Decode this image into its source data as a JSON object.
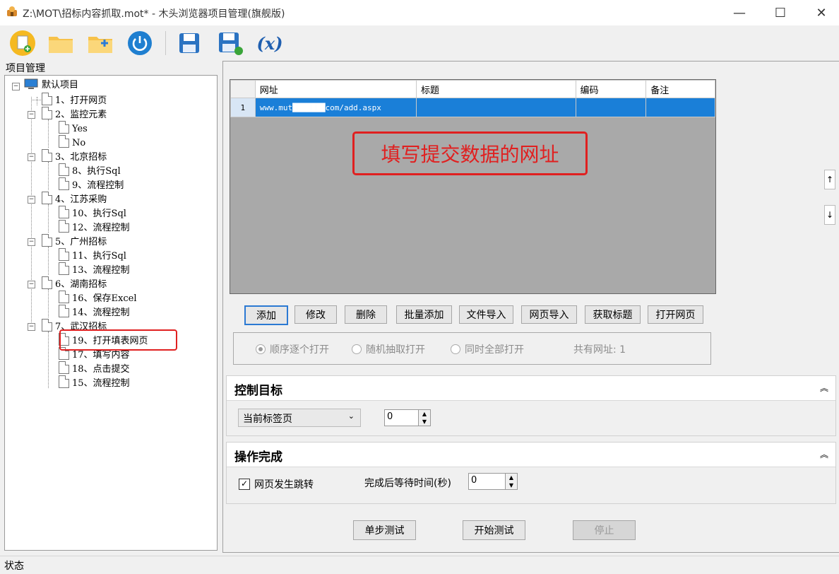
{
  "window": {
    "title": "Z:\\MOT\\招标内容抓取.mot* - 木头浏览器项目管理(旗舰版)",
    "minimize": "—",
    "maximize": "☐",
    "close": "✕"
  },
  "toolbar": {
    "items": [
      {
        "name": "new-project",
        "icon": "new-document-icon"
      },
      {
        "name": "open-project",
        "icon": "folder-icon"
      },
      {
        "name": "add-folder",
        "icon": "folder-add-icon"
      },
      {
        "name": "power",
        "icon": "power-icon"
      },
      {
        "name": "save",
        "icon": "save-icon"
      },
      {
        "name": "save-as",
        "icon": "save-as-icon"
      },
      {
        "name": "variables",
        "icon": "variable-icon",
        "label": "(x)"
      }
    ]
  },
  "project_panel": {
    "label": "项目管理",
    "tree": [
      {
        "label": "默认项目"
      },
      {
        "label": "1、打开网页"
      },
      {
        "label": "2、监控元素"
      },
      {
        "label": "Yes"
      },
      {
        "label": "No"
      },
      {
        "label": "3、北京招标"
      },
      {
        "label": "8、执行Sql"
      },
      {
        "label": "9、流程控制"
      },
      {
        "label": "4、江苏采购"
      },
      {
        "label": "10、执行Sql"
      },
      {
        "label": "12、流程控制"
      },
      {
        "label": "5、广州招标"
      },
      {
        "label": "11、执行Sql"
      },
      {
        "label": "13、流程控制"
      },
      {
        "label": "6、湖南招标"
      },
      {
        "label": "16、保存Excel"
      },
      {
        "label": "14、流程控制"
      },
      {
        "label": "7、武汉招标"
      },
      {
        "label": "19、打开填表网页"
      },
      {
        "label": "17、填写内容"
      },
      {
        "label": "18、点击提交"
      },
      {
        "label": "15、流程控制"
      }
    ]
  },
  "url_grid": {
    "columns": [
      "网址",
      "标题",
      "编码",
      "备注"
    ],
    "rows": [
      {
        "index": "1",
        "url": "www.mut███████com/add.aspx",
        "title": "",
        "encoding": "",
        "note": ""
      }
    ],
    "annotation": "填写提交数据的网址",
    "move_up": "↑",
    "move_down": "↓"
  },
  "url_buttons": {
    "add": "添加",
    "edit": "修改",
    "delete": "删除",
    "batch_add": "批量添加",
    "file_import": "文件导入",
    "web_import": "网页导入",
    "get_title": "获取标题",
    "open_page": "打开网页"
  },
  "open_mode": {
    "options": [
      "顺序逐个打开",
      "随机抽取打开",
      "同时全部打开"
    ],
    "selected": "顺序逐个打开",
    "count_text": "共有网址: 1"
  },
  "control_target": {
    "header": "控制目标",
    "collapse": "︽",
    "tab_select": "当前标签页",
    "index_value": "0"
  },
  "operation_complete": {
    "header": "操作完成",
    "collapse": "︽",
    "page_jump_label": "网页发生跳转",
    "page_jump_checked": true,
    "wait_label": "完成后等待时间(秒)",
    "wait_value": "0"
  },
  "test_buttons": {
    "step_test": "单步测试",
    "start_test": "开始测试",
    "stop": "停止"
  },
  "status": {
    "text": "状态"
  }
}
